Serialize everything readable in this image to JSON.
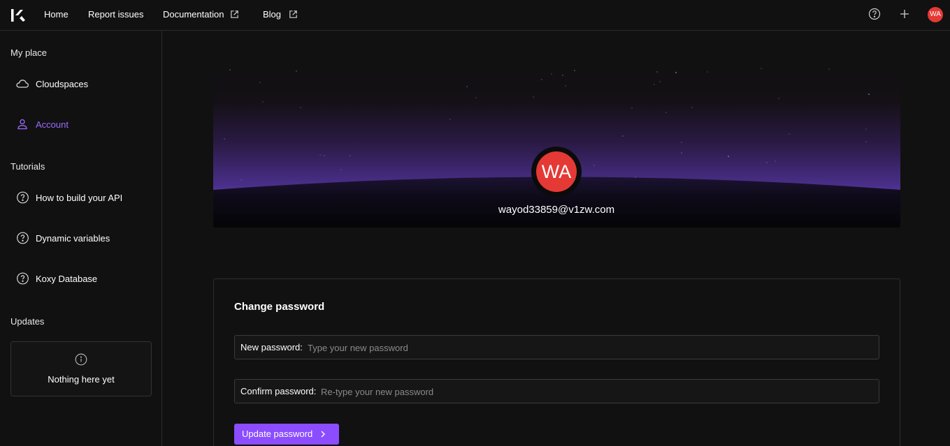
{
  "topbar": {
    "nav": [
      {
        "label": "Home"
      },
      {
        "label": "Report issues"
      },
      {
        "label": "Documentation",
        "external": true
      },
      {
        "label": "Blog",
        "external": true
      }
    ],
    "avatar_initials": "WA"
  },
  "sidebar": {
    "sections": [
      {
        "title": "My place"
      },
      {
        "title": "Tutorials"
      },
      {
        "title": "Updates"
      }
    ],
    "my_place_items": [
      {
        "label": "Cloudspaces",
        "icon": "cloud-icon"
      },
      {
        "label": "Account",
        "icon": "user-icon",
        "active": true
      }
    ],
    "tutorial_items": [
      {
        "label": "How to build your API",
        "icon": "help-circle-icon"
      },
      {
        "label": "Dynamic variables",
        "icon": "help-circle-icon"
      },
      {
        "label": "Koxy Database",
        "icon": "help-circle-icon"
      }
    ],
    "updates_empty": "Nothing here yet"
  },
  "profile": {
    "avatar_initials": "WA",
    "email": "wayod33859@v1zw.com"
  },
  "change_password": {
    "title": "Change password",
    "new_label": "New password:",
    "new_placeholder": "Type your new password",
    "confirm_label": "Confirm password:",
    "confirm_placeholder": "Re-type your new password",
    "submit_label": "Update password"
  },
  "colors": {
    "background": "#111111",
    "accent": "#8b4dff",
    "active_text": "#9b6bff",
    "avatar": "#e53935"
  }
}
